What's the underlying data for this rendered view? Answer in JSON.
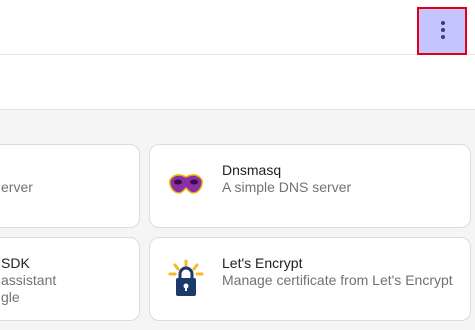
{
  "toolbar": {
    "menu_icon": "more-vert-icon"
  },
  "addons": [
    {
      "name": "",
      "description": "erver"
    },
    {
      "name": "Dnsmasq",
      "description": "A simple DNS server",
      "icon": "mask-icon"
    },
    {
      "name": "SDK",
      "description": "assistant",
      "description_2": "gle"
    },
    {
      "name": "Let's Encrypt",
      "description": "Manage certificate from Let's Encrypt",
      "icon": "lock-sun-icon"
    }
  ],
  "colors": {
    "highlight_fill": "#c4c4ff",
    "highlight_border": "#e0001a",
    "mask_purple": "#8b2fa8",
    "mask_gold": "#e6b800",
    "lock_blue": "#1a3a6b",
    "sun_yellow": "#f9b825"
  }
}
